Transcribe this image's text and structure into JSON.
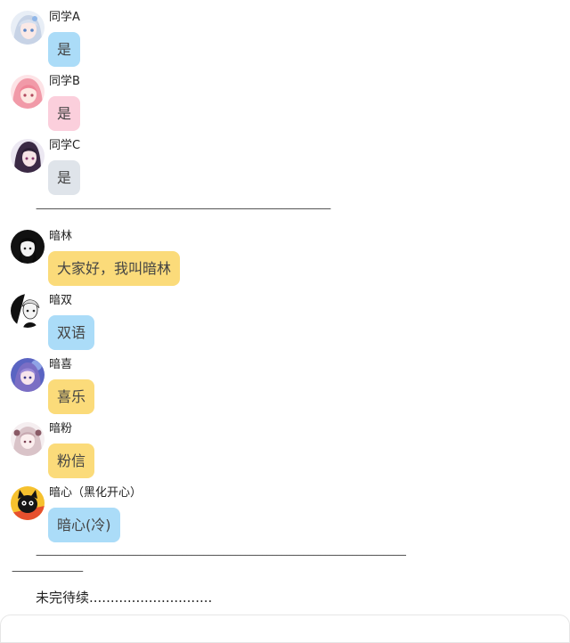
{
  "messages": [
    {
      "name": "同学A",
      "text": "是",
      "bubble": "blue",
      "avatar": "avatar-silver-hair-girl-icon"
    },
    {
      "name": "同学B",
      "text": "是",
      "bubble": "pink",
      "avatar": "avatar-pink-hair-girl-icon"
    },
    {
      "name": "同学C",
      "text": "是",
      "bubble": "gray",
      "avatar": "avatar-dark-hair-girl-icon"
    },
    {
      "name": "暗林",
      "text": "大家好，我叫暗林",
      "bubble": "yellow",
      "avatar": "avatar-black-hair-girl-icon"
    },
    {
      "name": "暗双",
      "text": "双语",
      "bubble": "blue",
      "avatar": "avatar-monochrome-girl-icon"
    },
    {
      "name": "暗喜",
      "text": "喜乐",
      "bubble": "yellow",
      "avatar": "avatar-purple-hair-girl-icon"
    },
    {
      "name": "暗粉",
      "text": "粉信",
      "bubble": "yellow",
      "avatar": "avatar-pale-hair-girl-icon"
    },
    {
      "name": "暗心（黑化开心）",
      "text": "暗心(冷)",
      "bubble": "blue",
      "avatar": "avatar-black-cat-icon"
    }
  ],
  "separator_1": "-------------------------------------------------------------------------------------------------------------------------",
  "separator_2_line1": "--------------------------------------------------------------------------------------------------------------------------------------------------------",
  "separator_2_line2": "-----------------------------",
  "to_be_continued": "未完待续.............................",
  "colors": {
    "bubble_blue": "#abdcf8",
    "bubble_pink": "#fbcfdc",
    "bubble_gray": "#dfe4ea",
    "bubble_yellow": "#fbdb7a"
  }
}
